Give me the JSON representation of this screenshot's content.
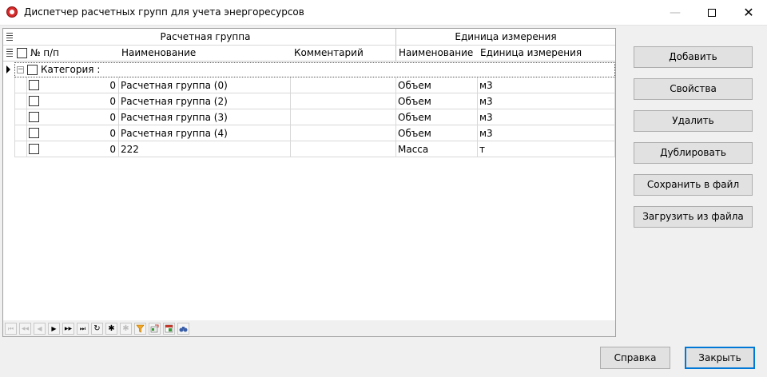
{
  "window": {
    "title": "Диспетчер расчетных групп для учета энергоресурсов",
    "minimize_glyph": "—",
    "close_glyph": "✕"
  },
  "grid": {
    "band_group": "Расчетная группа",
    "band_unit": "Единица измерения",
    "columns": {
      "num": "№ п/п",
      "name": "Наименование",
      "comment": "Комментарий",
      "unit_name": "Наименование",
      "unit_measure": "Единица измерения"
    },
    "group_label": "Категория :",
    "expander_glyph": "−",
    "rows": [
      {
        "num": "0",
        "name": "Расчетная группа (0)",
        "comment": "",
        "unit_name": "Объем",
        "unit_measure": "м3"
      },
      {
        "num": "0",
        "name": "Расчетная группа (2)",
        "comment": "",
        "unit_name": "Объем",
        "unit_measure": "м3"
      },
      {
        "num": "0",
        "name": "Расчетная группа (3)",
        "comment": "",
        "unit_name": "Объем",
        "unit_measure": "м3"
      },
      {
        "num": "0",
        "name": "Расчетная группа (4)",
        "comment": "",
        "unit_name": "Объем",
        "unit_measure": "м3"
      },
      {
        "num": "0",
        "name": "222",
        "comment": "",
        "unit_name": "Масса",
        "unit_measure": "т"
      }
    ]
  },
  "navigator": {
    "first": "⏮",
    "prev_page": "◀◀",
    "prev": "◀",
    "next": "▶",
    "next_page": "▶▶",
    "last": "⏭",
    "refresh": "↻",
    "insert": "✱",
    "delete": "✱"
  },
  "buttons": {
    "add": "Добавить",
    "properties": "Свойства",
    "delete": "Удалить",
    "duplicate": "Дублировать",
    "save_file": "Сохранить в файл",
    "load_file": "Загрузить из файла",
    "help": "Справка",
    "close": "Закрыть"
  },
  "colors": {
    "accent": "#0078d7",
    "filter_icon": "#f5a623",
    "export_icon": "#3a9a3a",
    "binoculars_icon": "#3a5fa8"
  }
}
